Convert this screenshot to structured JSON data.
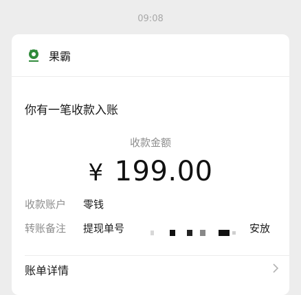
{
  "timestamp": "09:08",
  "sender": {
    "name": "果霸",
    "avatar_icon": "green-logo-icon"
  },
  "notice": {
    "title": "你有一笔收款入账"
  },
  "amount": {
    "label": "收款金额",
    "currency": "¥",
    "value": "199.00"
  },
  "fields": [
    {
      "key": "收款账户",
      "value": "零钱"
    },
    {
      "key": "转账备注",
      "value": "提现单号",
      "tail": "安放"
    }
  ],
  "details": {
    "label": "账单详情",
    "chevron_icon": "chevron-right-icon"
  },
  "colors": {
    "background": "#ededed",
    "card": "#ffffff",
    "brand": "#2f8a3a"
  }
}
